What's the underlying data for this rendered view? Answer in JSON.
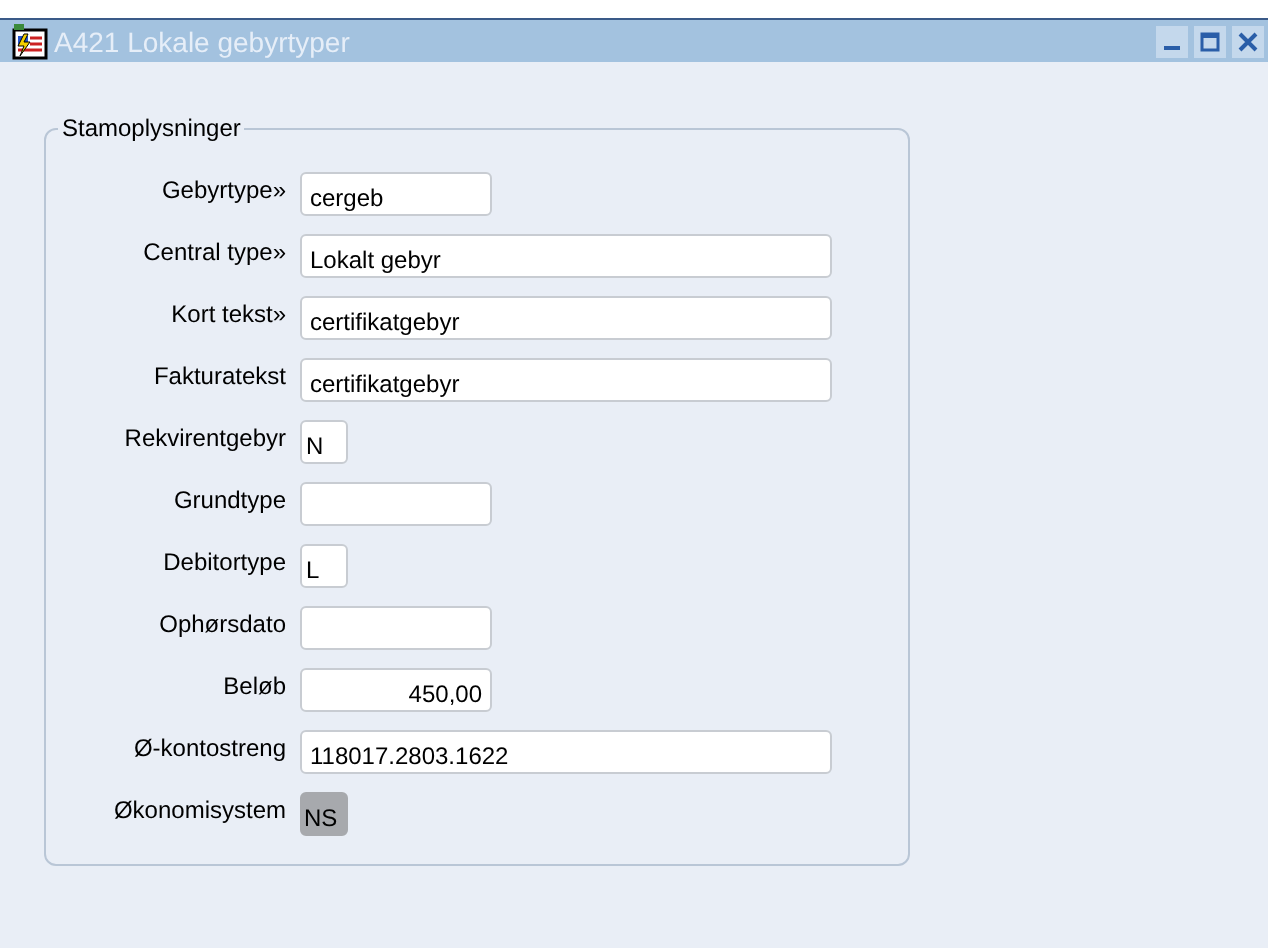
{
  "window": {
    "title": "A421 Lokale gebyrtyper"
  },
  "group": {
    "title": "Stamoplysninger",
    "fields": [
      {
        "label": "Gebyrtype»",
        "value": "cergeb",
        "kind": "short"
      },
      {
        "label": "Central type»",
        "value": "Lokalt gebyr",
        "kind": "long"
      },
      {
        "label": "Kort tekst»",
        "value": "certifikatgebyr",
        "kind": "long"
      },
      {
        "label": "Fakturatekst",
        "value": "certifikatgebyr",
        "kind": "long"
      },
      {
        "label": "Rekvirentgebyr",
        "value": "N",
        "kind": "char"
      },
      {
        "label": "Grundtype",
        "kind": "short"
      },
      {
        "label": "Debitortype",
        "value": "L",
        "kind": "char"
      },
      {
        "label": "Ophørsdato",
        "kind": "short"
      },
      {
        "label": "Beløb",
        "value": "450,00",
        "kind": "amount"
      },
      {
        "label": "Ø-kontostreng",
        "value": "118017.2803.1622",
        "kind": "long"
      },
      {
        "label": "Økonomisystem",
        "value": "NS",
        "kind": "display"
      }
    ]
  }
}
